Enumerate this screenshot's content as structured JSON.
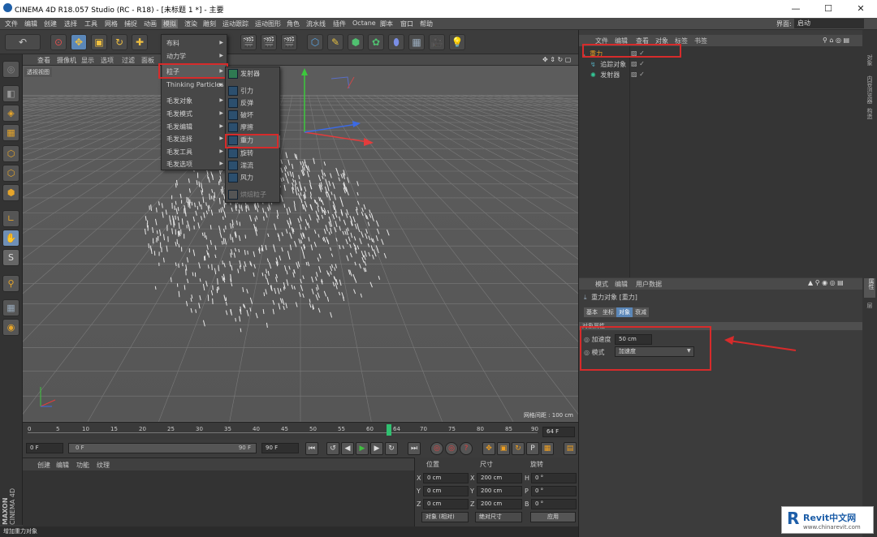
{
  "title": "CINEMA 4D R18.057 Studio (RC - R18) - [未标题 1 *] - 主要",
  "window_buttons": [
    "—",
    "☐",
    "✕"
  ],
  "menubar": [
    "文件",
    "编辑",
    "创建",
    "选择",
    "工具",
    "网格",
    "捕捉",
    "动画",
    "模拟",
    "渲染",
    "雕刻",
    "运动跟踪",
    "运动图形",
    "角色",
    "流水线",
    "插件",
    "Octane",
    "脚本",
    "窗口",
    "帮助"
  ],
  "layout_label": "界面:",
  "layout_value": "启动",
  "viewport": {
    "menu": [
      "查看",
      "摄像机",
      "显示",
      "选项",
      "过滤",
      "面板"
    ],
    "label": "透视视图",
    "grid_spacing": "网格间距 : 100 cm"
  },
  "simulate_menu": {
    "items": [
      "布料",
      "动力学",
      "粒子",
      "Thinking Particles",
      "毛发对象",
      "毛发模式",
      "毛发编辑",
      "毛发选择",
      "毛发工具",
      "毛发选项"
    ],
    "highlighted": "粒子"
  },
  "particle_submenu": {
    "items": [
      "发射器",
      "引力",
      "反弹",
      "破坏",
      "摩擦",
      "重力",
      "旋转",
      "湍流",
      "风力",
      "烘焙粒子"
    ],
    "highlighted": "重力"
  },
  "timeline": {
    "ticks": [
      "0",
      "5",
      "10",
      "15",
      "20",
      "25",
      "30",
      "35",
      "40",
      "45",
      "50",
      "55",
      "60",
      "64",
      "70",
      "75",
      "80",
      "85",
      "90"
    ],
    "current_frame": "64",
    "end_label": "64 F"
  },
  "playback": {
    "start": "0 F",
    "range_start": "0 F",
    "range_end": "90 F",
    "end": "90 F"
  },
  "material_menu": [
    "创建",
    "编辑",
    "功能",
    "纹理"
  ],
  "coords": {
    "headers": [
      "位置",
      "尺寸",
      "旋转"
    ],
    "rows": [
      {
        "axis": "X",
        "pos": "0 cm",
        "size_axis": "X",
        "size": "200 cm",
        "rot_axis": "H",
        "rot": "0 °"
      },
      {
        "axis": "Y",
        "pos": "0 cm",
        "size_axis": "Y",
        "size": "200 cm",
        "rot_axis": "P",
        "rot": "0 °"
      },
      {
        "axis": "Z",
        "pos": "0 cm",
        "size_axis": "Z",
        "size": "200 cm",
        "rot_axis": "B",
        "rot": "0 °"
      }
    ],
    "mode_object": "对象 (相对)",
    "mode_size": "绝对尺寸",
    "apply": "应用"
  },
  "status": "增加重力对象",
  "object_manager": {
    "menu": [
      "文件",
      "编辑",
      "查看",
      "对象",
      "标签",
      "书签"
    ],
    "objects": [
      "重力",
      "追踪对象",
      "发射器"
    ]
  },
  "attributes": {
    "menu": [
      "模式",
      "编辑",
      "用户数据"
    ],
    "object_title": "重力对象 [重力]",
    "tabs": [
      "基本",
      "坐标",
      "对象",
      "衰减"
    ],
    "active_tab": "对象",
    "section": "对象属性",
    "accel_label": "加速度",
    "accel_value": "50 cm",
    "mode_label": "模式",
    "mode_value": "加速度"
  },
  "side_tabs": [
    "对象",
    "内容浏览器",
    "构造",
    "属性",
    "层"
  ],
  "branding": {
    "maxon": "MAXON",
    "c4d": "CINEMA 4D"
  },
  "watermark": {
    "brand": "Revit中文网",
    "url": "www.chinarevit.com"
  },
  "colors": {
    "highlight_red": "#d72b2b",
    "accent_blue": "#5b87b8",
    "menu_active": "#b03030"
  }
}
